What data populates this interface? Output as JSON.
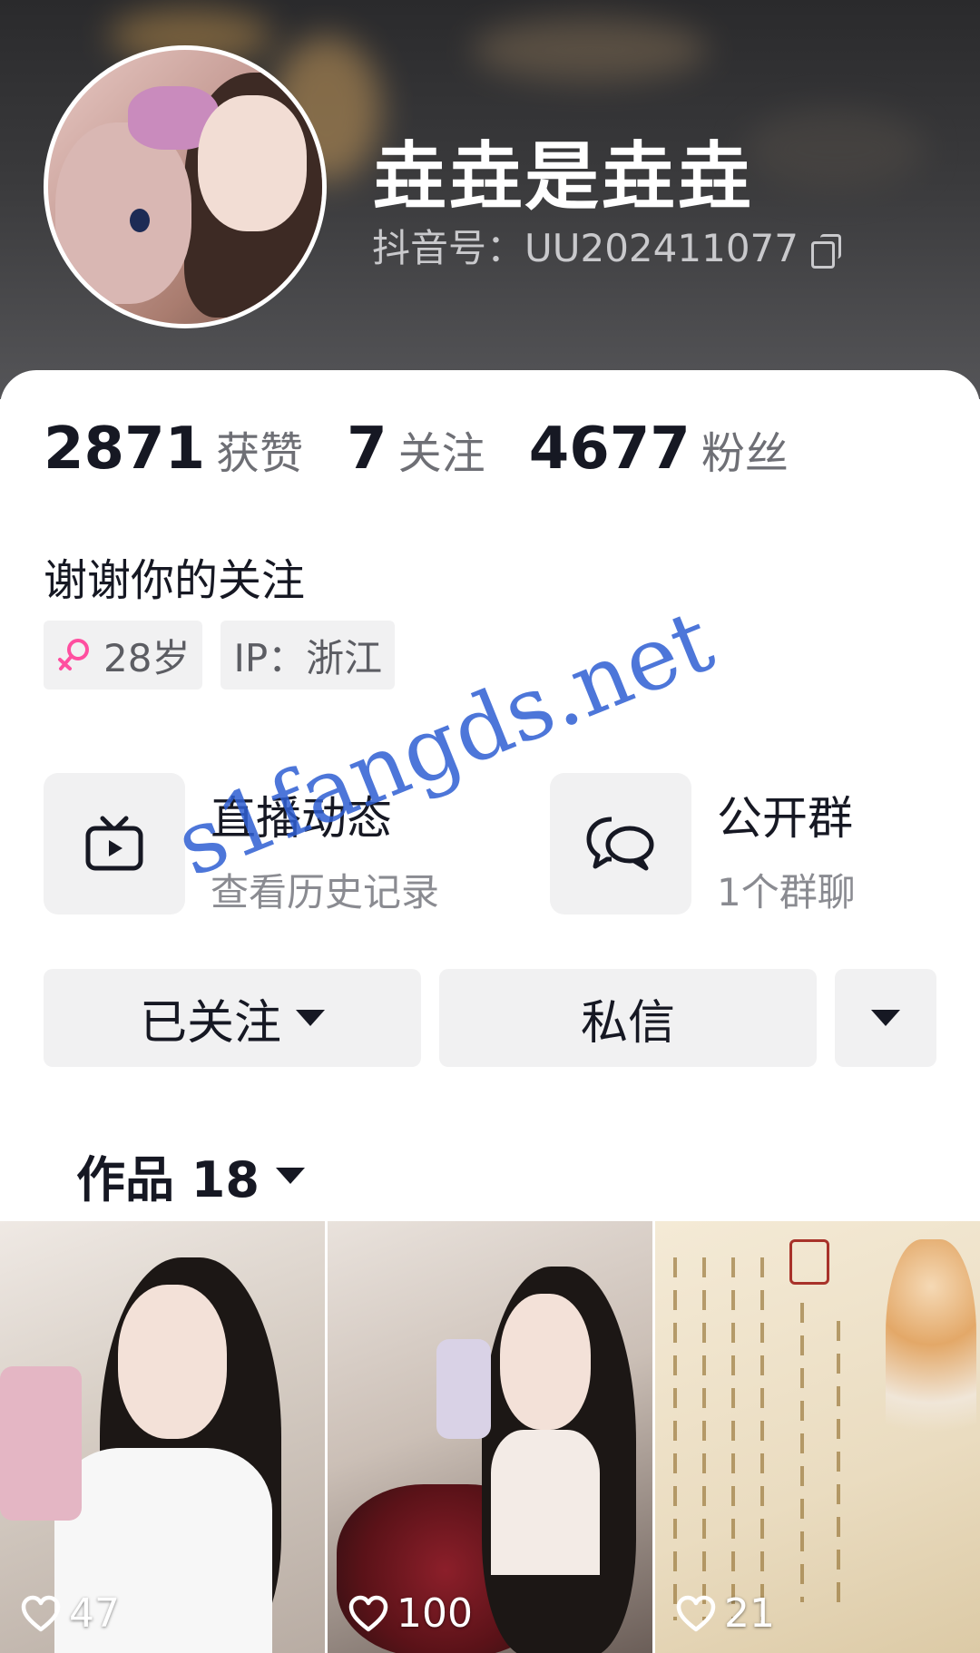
{
  "profile": {
    "nickname": "垚垚是垚垚",
    "douyin_id": "抖音号：UU202411077"
  },
  "stats": [
    {
      "value": "2871",
      "label": "获赞"
    },
    {
      "value": "7",
      "label": "关注"
    },
    {
      "value": "4677",
      "label": "粉丝"
    }
  ],
  "bio": "谢谢你的关注",
  "tags": {
    "age": "28岁",
    "ip": "IP：浙江"
  },
  "features": [
    {
      "title": "直播动态",
      "subtitle": "查看历史记录",
      "icon": "tv-icon"
    },
    {
      "title": "公开群",
      "subtitle": "1个群聊",
      "icon": "group-chat-icon"
    }
  ],
  "actions": {
    "follow_label": "已关注",
    "message_label": "私信"
  },
  "works": {
    "label": "作品 18"
  },
  "videos": [
    {
      "likes": "47"
    },
    {
      "likes": "100"
    },
    {
      "likes": "21"
    }
  ],
  "watermark": "s1fangds.net",
  "colors": {
    "accent_female": "#ff4fa0",
    "watermark": "#2f5fd3",
    "chip_bg": "#f1f1f2"
  }
}
